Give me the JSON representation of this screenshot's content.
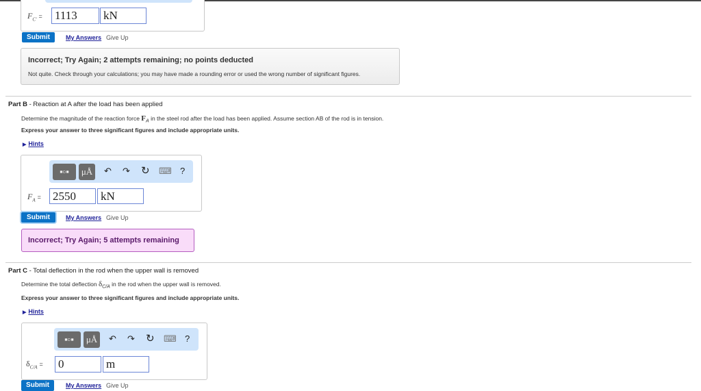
{
  "part_a": {
    "label": "F",
    "label_sub": "C'",
    "equals": "=",
    "value": "1113",
    "unit": "kN",
    "submit": "Submit",
    "my_answers": "My Answers",
    "give_up": "Give Up",
    "feedback_title": "Incorrect; Try Again; 2 attempts remaining; no points deducted",
    "feedback_body": "Not quite. Check through your calculations; you may have made a rounding error or used the wrong number of significant figures."
  },
  "part_b": {
    "title_prefix": "Part B",
    "title": " - Reaction at A after the load has been applied",
    "desc_pre": "Determine the magnitude of the reaction force ",
    "desc_sym": "F",
    "desc_sub": "A",
    "desc_post": " in the steel rod after the load has been applied. Assume section AB of the rod is in tension.",
    "express": "Express your answer to three significant figures and include appropriate units.",
    "hints": "Hints",
    "label": "F",
    "label_sub": "A",
    "equals": "=",
    "value": "2550",
    "unit": "kN",
    "submit": "Submit",
    "my_answers": "My Answers",
    "give_up": "Give Up",
    "feedback": "Incorrect; Try Again; 5 attempts remaining"
  },
  "part_c": {
    "title_prefix": "Part C",
    "title": " - Total deflection in the rod when the upper wall is removed",
    "desc_pre": "Determine the total deflection ",
    "desc_sym": "δ",
    "desc_sub": "C/A",
    "desc_post": " in the rod when the upper wall is removed.",
    "express": "Express your answer to three significant figures and include appropriate units.",
    "hints": "Hints",
    "label": "δ",
    "label_sub": "C/A",
    "equals": "=",
    "value": "0",
    "unit": "m",
    "submit": "Submit",
    "my_answers": "My Answers",
    "give_up": "Give Up"
  },
  "toolbar": {
    "units_btn": "μÅ",
    "help": "?",
    "undo": "↶",
    "redo": "↷",
    "reset": "↻",
    "keyboard": "⌨"
  }
}
